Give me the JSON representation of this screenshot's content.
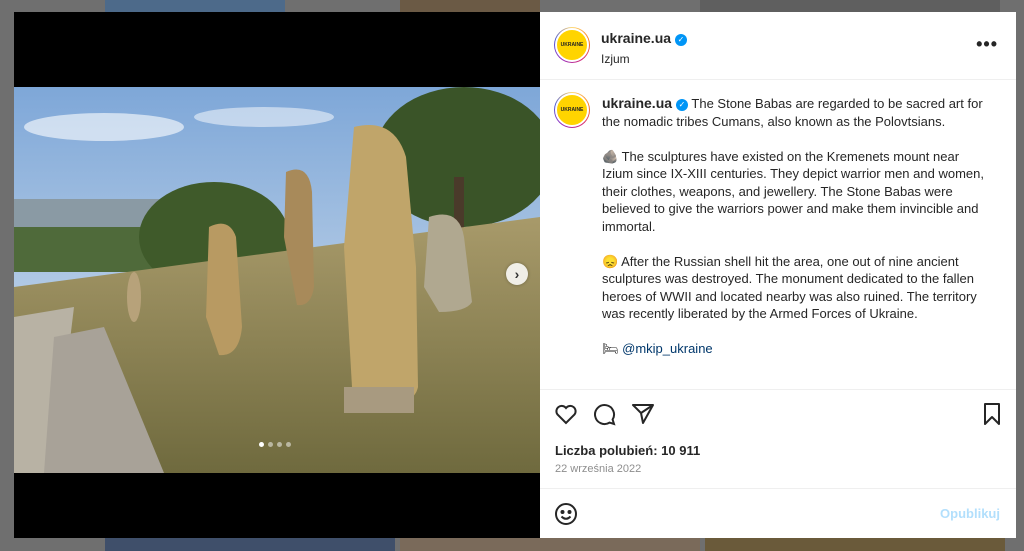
{
  "post": {
    "username": "ukraine.ua",
    "location": "Izjum",
    "avatar_text": "UKRAINE",
    "more_label": "•••",
    "caption_paragraphs": [
      "The Stone Babas are regarded to be sacred art for the nomadic tribes Cumans, also known as the Polovtsians.",
      "🪨 The sculptures have existed on the Kremenets mount near Izium since IX-XIII centuries. They depict warrior men and women, their clothes, weapons, and jewellery. The Stone Babas were believed to give the warriors power and make them invincible and immortal.",
      "😞 After the Russian shell hit the area, one out of nine ancient sculptures was destroyed. The monument dedicated to the fallen heroes of WWII and located nearby was also ruined. The territory was recently liberated by the Armed Forces of Ukraine."
    ],
    "mention_emoji": "🛏",
    "mention": "@mkip_ukraine",
    "likes": "Liczba polubień: 10 911",
    "date": "22 września 2022",
    "publish_label": "Opublikuj"
  },
  "carousel": {
    "slides": 4,
    "active": 0
  },
  "icons": {
    "like": "heart-icon",
    "comment": "comment-icon",
    "share": "share-icon",
    "save": "bookmark-icon",
    "emoji": "emoji-icon",
    "next": "chevron-right-icon"
  },
  "colors": {
    "verified": "#0095f6",
    "mention": "#00376b",
    "publish_disabled": "#b2dffc"
  }
}
